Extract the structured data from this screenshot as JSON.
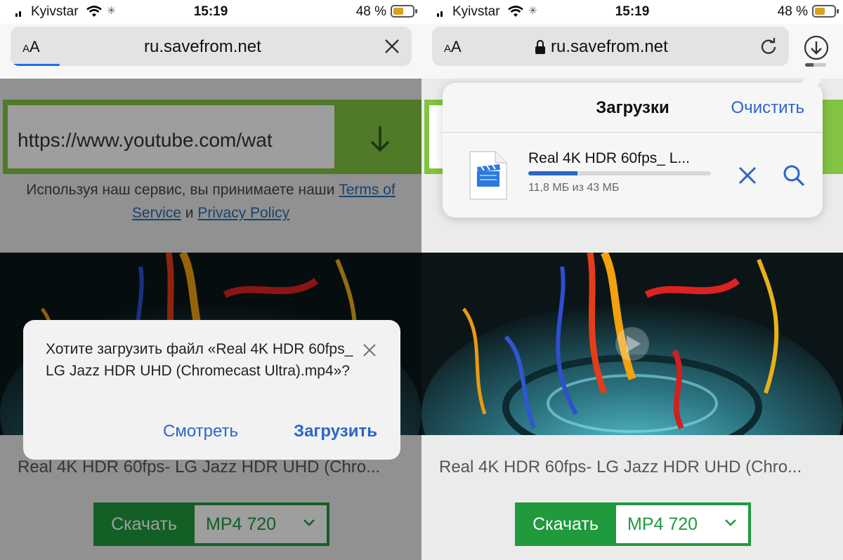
{
  "status_bar": {
    "carrier": "Kyivstar",
    "time": "15:19",
    "battery_percent": "48 %",
    "battery_level": 0.48
  },
  "left": {
    "toolbar": {
      "text_size_label": "AA",
      "url": "ru.savefrom.net"
    },
    "page": {
      "url_input_value": "https://www.youtube.com/wat",
      "terms_prefix": "Используя наш сервис, вы принимаете наши",
      "terms_link": "Terms of Service",
      "terms_and": "и",
      "privacy_link": "Privacy Policy",
      "video_title": "Real 4K HDR 60fps- LG Jazz HDR UHD (Chro...",
      "download_button": "Скачать",
      "format_select": "MP4  720"
    },
    "dialog": {
      "message": "Хотите загрузить файл «Real 4K HDR 60fps_ LG Jazz HDR UHD (Chromecast Ultra).mp4»?",
      "watch_button": "Смотреть",
      "download_button": "Загрузить"
    }
  },
  "right": {
    "toolbar": {
      "text_size_label": "AA",
      "url": "ru.savefrom.net"
    },
    "page": {
      "video_title": "Real 4K HDR 60fps- LG Jazz HDR UHD (Chro...",
      "download_button": "Скачать",
      "format_select": "MP4  720"
    },
    "downloads": {
      "title": "Загрузки",
      "clear_button": "Очистить",
      "file_name": "Real 4K HDR 60fps_ L...",
      "progress_text": "11,8 МБ из 43 МБ",
      "progress_fraction": 0.27
    }
  },
  "colors": {
    "accent_blue": "#2b66c8",
    "page_green": "#82c341",
    "download_green": "#1f9a3d"
  }
}
